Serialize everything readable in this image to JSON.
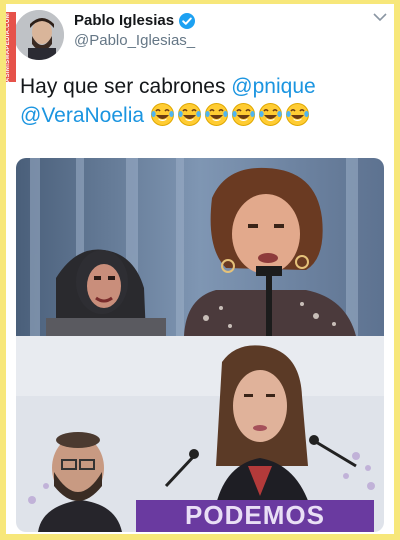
{
  "tweet": {
    "author_name": "Pablo Iglesias",
    "author_handle": "@Pablo_Iglesias_",
    "text_intro": "Hay que ser cabrones",
    "mention_1": "@pnique",
    "mention_2": "@VeraNoelia",
    "emoji": [
      "face-with-tears-of-joy",
      "face-with-tears-of-joy",
      "face-with-tears-of-joy",
      "face-with-tears-of-joy",
      "face-with-tears-of-joy",
      "face-with-tears-of-joy"
    ]
  },
  "watermark": {
    "text": "ASÍMISMAPEDIA.COM"
  },
  "media": {
    "bottom_photo_sign_text": "PODEMOS"
  },
  "colors": {
    "frame": "#f7e77a",
    "mention": "#1b95e0",
    "verified": "#1da1f2",
    "text": "#14171a",
    "muted": "#657786"
  }
}
